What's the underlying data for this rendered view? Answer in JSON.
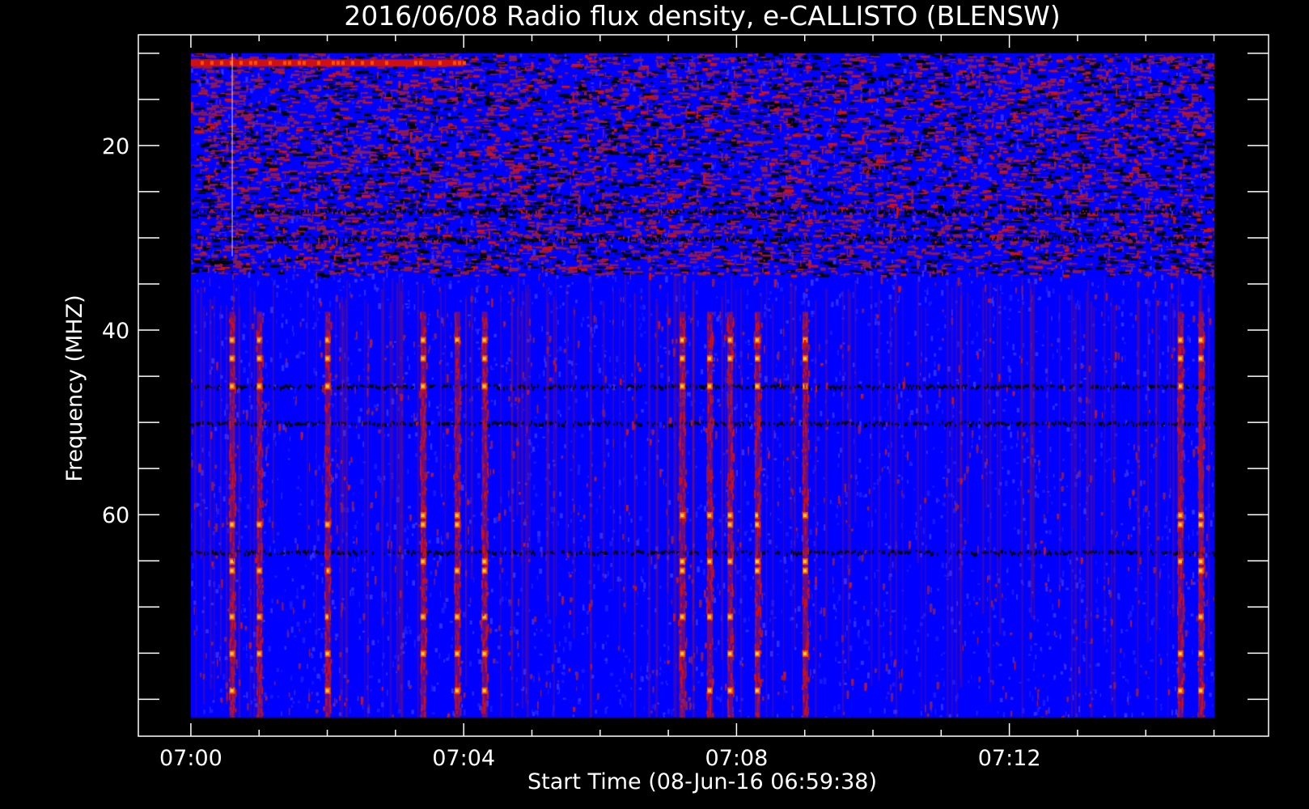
{
  "chart_data": {
    "type": "heatmap",
    "title": "2016/06/08  Radio flux density, e-CALLISTO (BLENSW)",
    "xlabel": "Start Time (08-Jun-16 06:59:38)",
    "ylabel": "Frequency (MHZ)",
    "x_ticks": [
      {
        "label": "07:00",
        "minute": 0
      },
      {
        "label": "07:04",
        "minute": 4
      },
      {
        "label": "07:08",
        "minute": 8
      },
      {
        "label": "07:12",
        "minute": 12
      }
    ],
    "y_ticks": [
      20,
      40,
      60
    ],
    "xlim_minutes_after_0700": [
      -0.77,
      15.8
    ],
    "data_x_range_minutes_after_0700": [
      0,
      15
    ],
    "ylim_mhz": [
      8,
      84
    ],
    "data_y_range_mhz": [
      10,
      82
    ],
    "colormap": [
      "#000000",
      "#1a1aff",
      "#3030ff",
      "#8a1a55",
      "#d01010",
      "#ff5000",
      "#ffd040"
    ],
    "background_color": "#0000ff",
    "hot_time_columns_minutes": [
      0.6,
      1.0,
      2.0,
      3.4,
      3.9,
      4.3,
      7.2,
      7.6,
      7.9,
      8.3,
      9.0,
      14.5,
      14.8
    ],
    "dark_frequency_bands_mhz": [
      27,
      30,
      46,
      50,
      64
    ],
    "bright_frequency_band_mhz": 11
  }
}
